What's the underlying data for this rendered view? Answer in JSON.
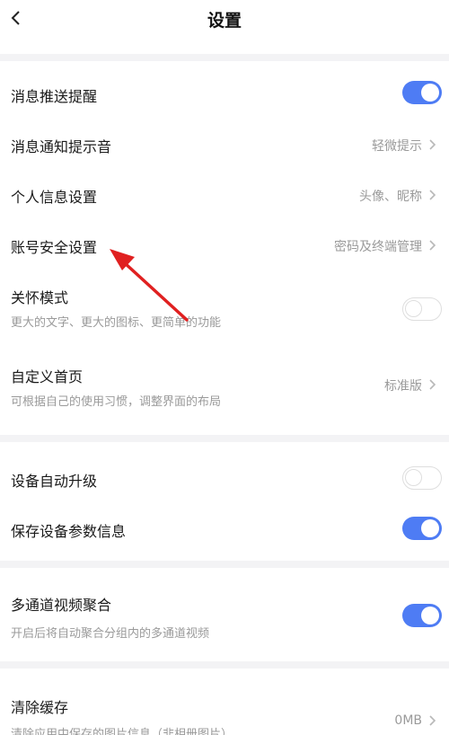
{
  "header": {
    "title": "设置",
    "back_icon": "chevron-left-icon"
  },
  "section1": {
    "push_alert": {
      "label": "消息推送提醒",
      "enabled": true
    },
    "notify_sound": {
      "label": "消息通知提示音",
      "value": "轻微提示"
    },
    "personal_info": {
      "label": "个人信息设置",
      "value": "头像、昵称"
    },
    "account_security": {
      "label": "账号安全设置",
      "value": "密码及终端管理"
    },
    "care_mode": {
      "label": "关怀模式",
      "desc": "更大的文字、更大的图标、更简单的功能",
      "enabled": false
    },
    "custom_home": {
      "label": "自定义首页",
      "desc": "可根据自己的使用习惯，调整界面的布局",
      "value": "标准版"
    }
  },
  "section2": {
    "auto_upgrade": {
      "label": "设备自动升级",
      "enabled": false
    },
    "save_params": {
      "label": "保存设备参数信息",
      "enabled": true
    }
  },
  "section3": {
    "multi_channel": {
      "label": "多通道视频聚合",
      "desc": "开启后将自动聚合分组内的多通道视频",
      "enabled": true
    }
  },
  "section4": {
    "clear_cache": {
      "label": "清除缓存",
      "desc": "清除应用中保存的图片信息（非相册图片）",
      "value": "0MB"
    }
  },
  "colors": {
    "accent": "#4e7cf4",
    "annotation_arrow": "#e02020"
  }
}
